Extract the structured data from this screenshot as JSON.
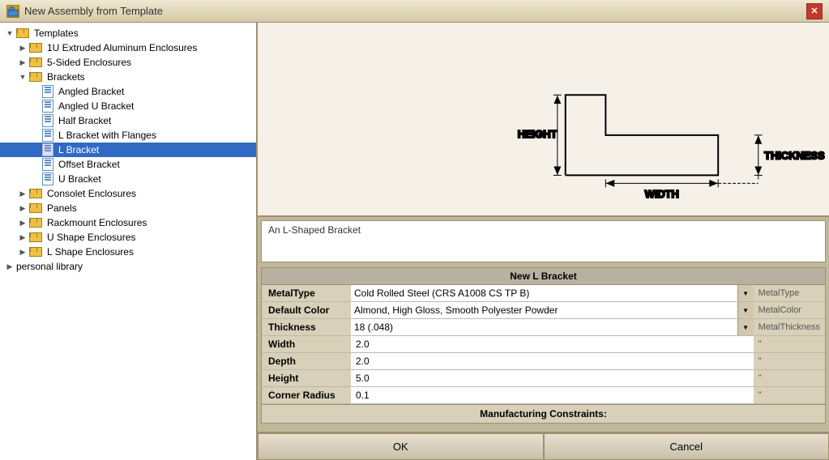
{
  "window": {
    "title": "New Assembly from Template",
    "close_label": "✕"
  },
  "tree": {
    "items": [
      {
        "id": "templates",
        "label": "Templates",
        "level": 0,
        "type": "root",
        "expanded": true
      },
      {
        "id": "1u",
        "label": "1U Extruded Aluminum Enclosures",
        "level": 1,
        "type": "folder"
      },
      {
        "id": "5sided",
        "label": "5-Sided Enclosures",
        "level": 1,
        "type": "folder"
      },
      {
        "id": "brackets",
        "label": "Brackets",
        "level": 1,
        "type": "folder",
        "expanded": true
      },
      {
        "id": "angled-bracket",
        "label": "Angled Bracket",
        "level": 2,
        "type": "doc"
      },
      {
        "id": "angled-u-bracket",
        "label": "Angled U Bracket",
        "level": 2,
        "type": "doc"
      },
      {
        "id": "half-bracket",
        "label": "Half Bracket",
        "level": 2,
        "type": "doc"
      },
      {
        "id": "l-bracket-flanges",
        "label": "L Bracket with Flanges",
        "level": 2,
        "type": "doc"
      },
      {
        "id": "l-bracket",
        "label": "L Bracket",
        "level": 2,
        "type": "doc",
        "selected": true
      },
      {
        "id": "offset-bracket",
        "label": "Offset Bracket",
        "level": 2,
        "type": "doc"
      },
      {
        "id": "u-bracket",
        "label": "U Bracket",
        "level": 2,
        "type": "doc"
      },
      {
        "id": "consolet",
        "label": "Consolet Enclosures",
        "level": 1,
        "type": "folder"
      },
      {
        "id": "panels",
        "label": "Panels",
        "level": 1,
        "type": "folder"
      },
      {
        "id": "rackmount",
        "label": "Rackmount Enclosures",
        "level": 1,
        "type": "folder"
      },
      {
        "id": "ushape",
        "label": "U Shape Enclosures",
        "level": 1,
        "type": "folder"
      },
      {
        "id": "lshape",
        "label": "L Shape Enclosures",
        "level": 1,
        "type": "folder"
      },
      {
        "id": "personal",
        "label": "personal library",
        "level": 0,
        "type": "root-plain"
      }
    ]
  },
  "diagram": {
    "description": "An L-Shaped Bracket"
  },
  "form": {
    "title": "New L Bracket",
    "fields": [
      {
        "label": "MetalType",
        "value": "Cold Rolled Steel (CRS A1008 CS TP B)",
        "type": "dropdown",
        "suffix": "MetalType"
      },
      {
        "label": "Default Color",
        "value": "Almond, High Gloss, Smooth Polyester Powder",
        "type": "dropdown",
        "suffix": "MetalColor"
      },
      {
        "label": "Thickness",
        "value": "18 (.048)",
        "type": "dropdown",
        "suffix": "MetalThickness"
      },
      {
        "label": "Width",
        "value": "2.0",
        "type": "text",
        "suffix": "\""
      },
      {
        "label": "Depth",
        "value": "2.0",
        "type": "text",
        "suffix": "\""
      },
      {
        "label": "Height",
        "value": "5.0",
        "type": "text",
        "suffix": "\""
      },
      {
        "label": "Corner Radius",
        "value": "0.1",
        "type": "text",
        "suffix": "\""
      }
    ],
    "mfg_label": "Manufacturing Constraints:",
    "ok_label": "OK",
    "cancel_label": "Cancel"
  }
}
